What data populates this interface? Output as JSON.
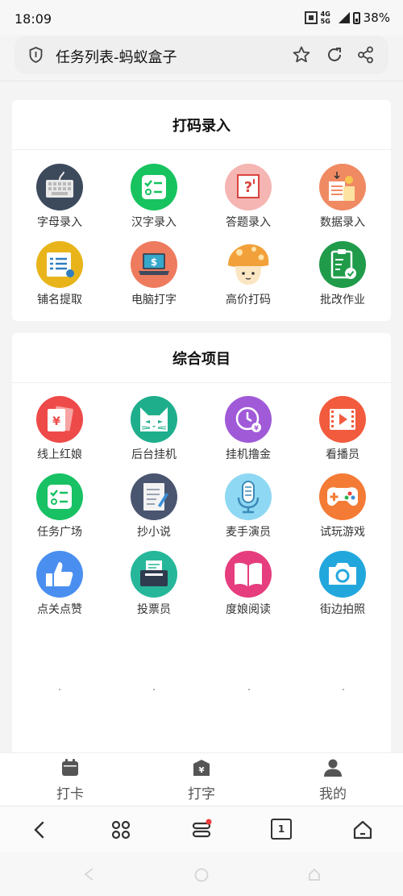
{
  "status_bar": {
    "time": "18:09",
    "network": "4G 5G",
    "battery": "38%"
  },
  "browser": {
    "title": "任务列表-蚂蚁盒子",
    "tab_count": "1"
  },
  "sections": [
    {
      "title": "打码录入",
      "items": [
        {
          "label": "字母录入",
          "icon": "keyboard-icon",
          "color": "#3d4a5c"
        },
        {
          "label": "汉字录入",
          "icon": "checklist-icon",
          "color": "#17c35f"
        },
        {
          "label": "答题录入",
          "icon": "question-board-icon",
          "color": "#f5b5b3"
        },
        {
          "label": "数据录入",
          "icon": "data-docs-icon",
          "color": "#f08a63"
        },
        {
          "label": "铺名提取",
          "icon": "document-icon",
          "color": "#e8b41a"
        },
        {
          "label": "电脑打字",
          "icon": "laptop-dollar-icon",
          "color": "#ee7b5e"
        },
        {
          "label": "高价打码",
          "icon": "mushroom-icon",
          "color": "#f2a13a"
        },
        {
          "label": "批改作业",
          "icon": "clipboard-check-icon",
          "color": "#1f9b4a"
        }
      ]
    },
    {
      "title": "综合项目",
      "items": [
        {
          "label": "线上红娘",
          "icon": "red-envelope-icon",
          "color": "#ee4a4a"
        },
        {
          "label": "后台挂机",
          "icon": "cat-icon",
          "color": "#1fae8c"
        },
        {
          "label": "挂机撸金",
          "icon": "clock-icon",
          "color": "#a05ad8"
        },
        {
          "label": "看播员",
          "icon": "video-play-icon",
          "color": "#f25b3d"
        },
        {
          "label": "任务广场",
          "icon": "task-list-icon",
          "color": "#18c164"
        },
        {
          "label": "抄小说",
          "icon": "notebook-icon",
          "color": "#4a5670"
        },
        {
          "label": "麦手演员",
          "icon": "microphone-icon",
          "color": "#8fd8f4"
        },
        {
          "label": "试玩游戏",
          "icon": "gamepad-icon",
          "color": "#f47b35"
        },
        {
          "label": "点关点赞",
          "icon": "thumbs-up-icon",
          "color": "#4a8ff0"
        },
        {
          "label": "投票员",
          "icon": "ballot-box-icon",
          "color": "#26b79a"
        },
        {
          "label": "度娘阅读",
          "icon": "book-icon",
          "color": "#e63d7e"
        },
        {
          "label": "街边拍照",
          "icon": "camera-icon",
          "color": "#22a7dd"
        }
      ]
    }
  ],
  "tabbar": [
    {
      "label": "打卡",
      "icon": "calendar-icon"
    },
    {
      "label": "打字",
      "icon": "typing-box-icon"
    },
    {
      "label": "我的",
      "icon": "user-icon"
    }
  ]
}
